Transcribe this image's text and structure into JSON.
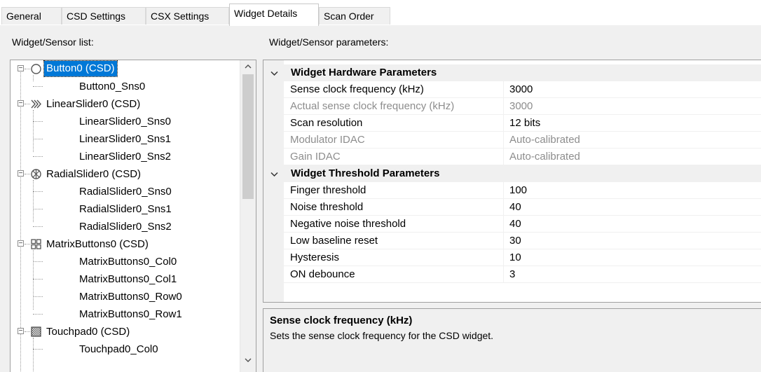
{
  "tabs": [
    "General",
    "CSD Settings",
    "CSX Settings",
    "Widget Details",
    "Scan Order"
  ],
  "active_tab": "Widget Details",
  "left_panel": {
    "label": "Widget/Sensor list:",
    "tree": [
      {
        "label": "Button0 (CSD)",
        "icon": "button-icon",
        "selected": true,
        "sensors": [
          "Button0_Sns0"
        ]
      },
      {
        "label": "LinearSlider0 (CSD)",
        "icon": "linear-slider-icon",
        "sensors": [
          "LinearSlider0_Sns0",
          "LinearSlider0_Sns1",
          "LinearSlider0_Sns2"
        ]
      },
      {
        "label": "RadialSlider0 (CSD)",
        "icon": "radial-slider-icon",
        "sensors": [
          "RadialSlider0_Sns0",
          "RadialSlider0_Sns1",
          "RadialSlider0_Sns2"
        ]
      },
      {
        "label": "MatrixButtons0 (CSD)",
        "icon": "matrix-buttons-icon",
        "sensors": [
          "MatrixButtons0_Col0",
          "MatrixButtons0_Col1",
          "MatrixButtons0_Row0",
          "MatrixButtons0_Row1"
        ]
      },
      {
        "label": "Touchpad0 (CSD)",
        "icon": "touchpad-icon",
        "sensors": [
          "Touchpad0_Col0"
        ]
      }
    ]
  },
  "right_panel": {
    "label": "Widget/Sensor parameters:",
    "categories": [
      {
        "title": "Widget Hardware Parameters",
        "props": [
          {
            "name": "Sense clock frequency (kHz)",
            "value": "3000",
            "readonly": false
          },
          {
            "name": "Actual sense clock frequency (kHz)",
            "value": "3000",
            "readonly": true
          },
          {
            "name": "Scan resolution",
            "value": "12 bits",
            "readonly": false
          },
          {
            "name": "Modulator IDAC",
            "value": "Auto-calibrated",
            "readonly": true
          },
          {
            "name": "Gain IDAC",
            "value": "Auto-calibrated",
            "readonly": true
          }
        ]
      },
      {
        "title": "Widget Threshold Parameters",
        "props": [
          {
            "name": "Finger threshold",
            "value": "100",
            "readonly": false
          },
          {
            "name": "Noise threshold",
            "value": "40",
            "readonly": false
          },
          {
            "name": "Negative noise threshold",
            "value": "40",
            "readonly": false
          },
          {
            "name": "Low baseline reset",
            "value": "30",
            "readonly": false
          },
          {
            "name": "Hysteresis",
            "value": "10",
            "readonly": false
          },
          {
            "name": "ON debounce",
            "value": "3",
            "readonly": false
          }
        ]
      }
    ],
    "description": {
      "title": "Sense clock frequency (kHz)",
      "text": "Sets the sense clock frequency for the CSD widget."
    }
  },
  "colors": {
    "selection": "#0078d7",
    "panel_bg": "#f0f0f0",
    "readonly_text": "#8d8d8d",
    "border": "#a0a0a0"
  }
}
